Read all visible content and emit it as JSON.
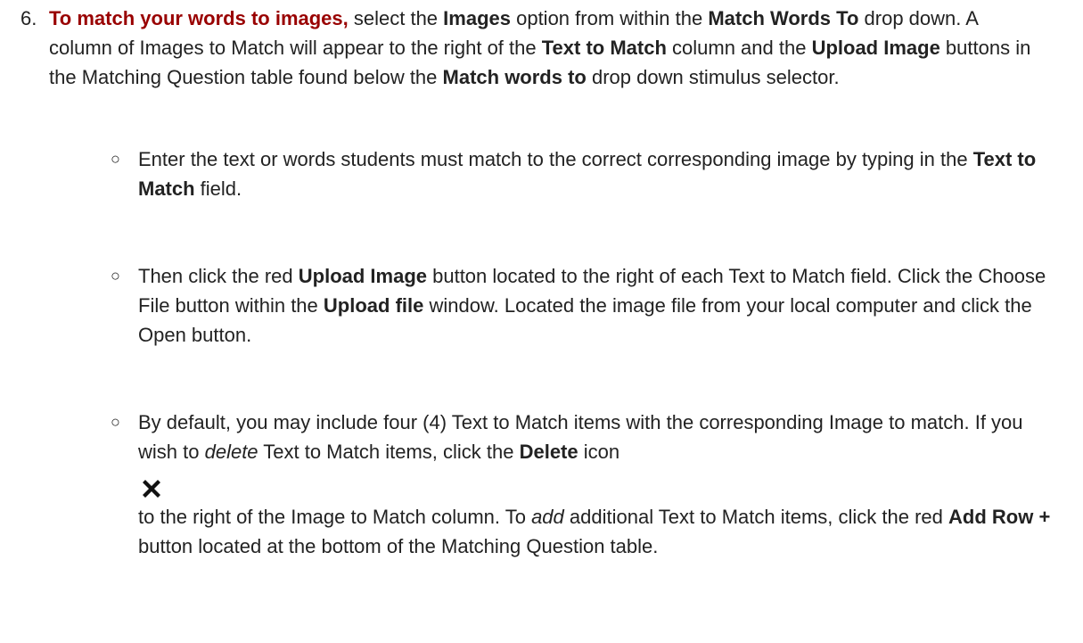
{
  "step": {
    "number": "6.",
    "lead": "To match your words to images,",
    "t1": " select the ",
    "b1": "Images",
    "t2": " option from within the ",
    "b2": "Match Words To",
    "t3": " drop down. A column of Images to Match will appear to the right of the ",
    "b3": "Text to Match",
    "t4": " column and the ",
    "b4": "Upload Image",
    "t5": " buttons in the Matching Question table found below the ",
    "b5": "Match words to",
    "t6": " drop down stimulus selector."
  },
  "bullets": [
    {
      "mark": "○",
      "t1": "Enter the text or words students must match to the correct corresponding image by typing in the ",
      "b1": "Text to Match",
      "t2": " field."
    },
    {
      "mark": "○",
      "t1": "Then click the red ",
      "b1": "Upload Image",
      "t2": " button located to the right of each Text to Match field.  Click the Choose File button within the ",
      "b2": "Upload file",
      "t3": " window. Located the image file from your local computer and click the Open button."
    },
    {
      "mark": "○",
      "t1": "By default, you may include four (4) Text to Match items with the corresponding Image to match. If you wish to ",
      "i1": "delete",
      "t2": " Text to Match items, click the ",
      "b1": "Delete",
      "t3": " icon",
      "t4": "to the right of the Image to Match column. To ",
      "i2": "add",
      "t5": " additional Text to Match items, click the red ",
      "b2": "Add Row +",
      "t6": " button located at the bottom of the Matching Question table."
    }
  ],
  "icons": {
    "delete": "delete-x-icon"
  },
  "colors": {
    "lead": "#990000",
    "text": "#222222",
    "icon": "#111111"
  }
}
